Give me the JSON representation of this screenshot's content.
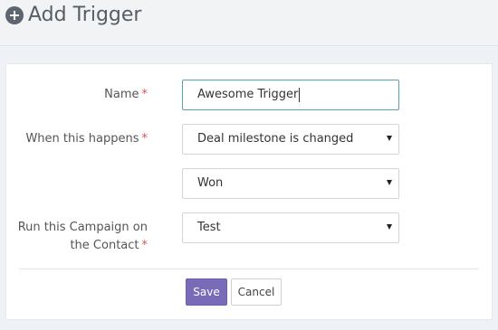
{
  "header": {
    "title": "Add Trigger",
    "icon": "plus-circle-icon"
  },
  "form": {
    "name": {
      "label": "Name",
      "required_mark": "*",
      "value": "Awesome Trigger"
    },
    "when": {
      "label": "When this happens",
      "required_mark": "*",
      "value": "Deal milestone is changed"
    },
    "milestone": {
      "value": "Won"
    },
    "campaign": {
      "label_line1": "Run this Campaign on",
      "label_line2": "the Contact",
      "required_mark": "*",
      "value": "Test"
    }
  },
  "actions": {
    "save_label": "Save",
    "cancel_label": "Cancel"
  },
  "colors": {
    "primary_button": "#7a6bb9",
    "required_star": "#d9534f",
    "active_border": "#56a3b0"
  }
}
